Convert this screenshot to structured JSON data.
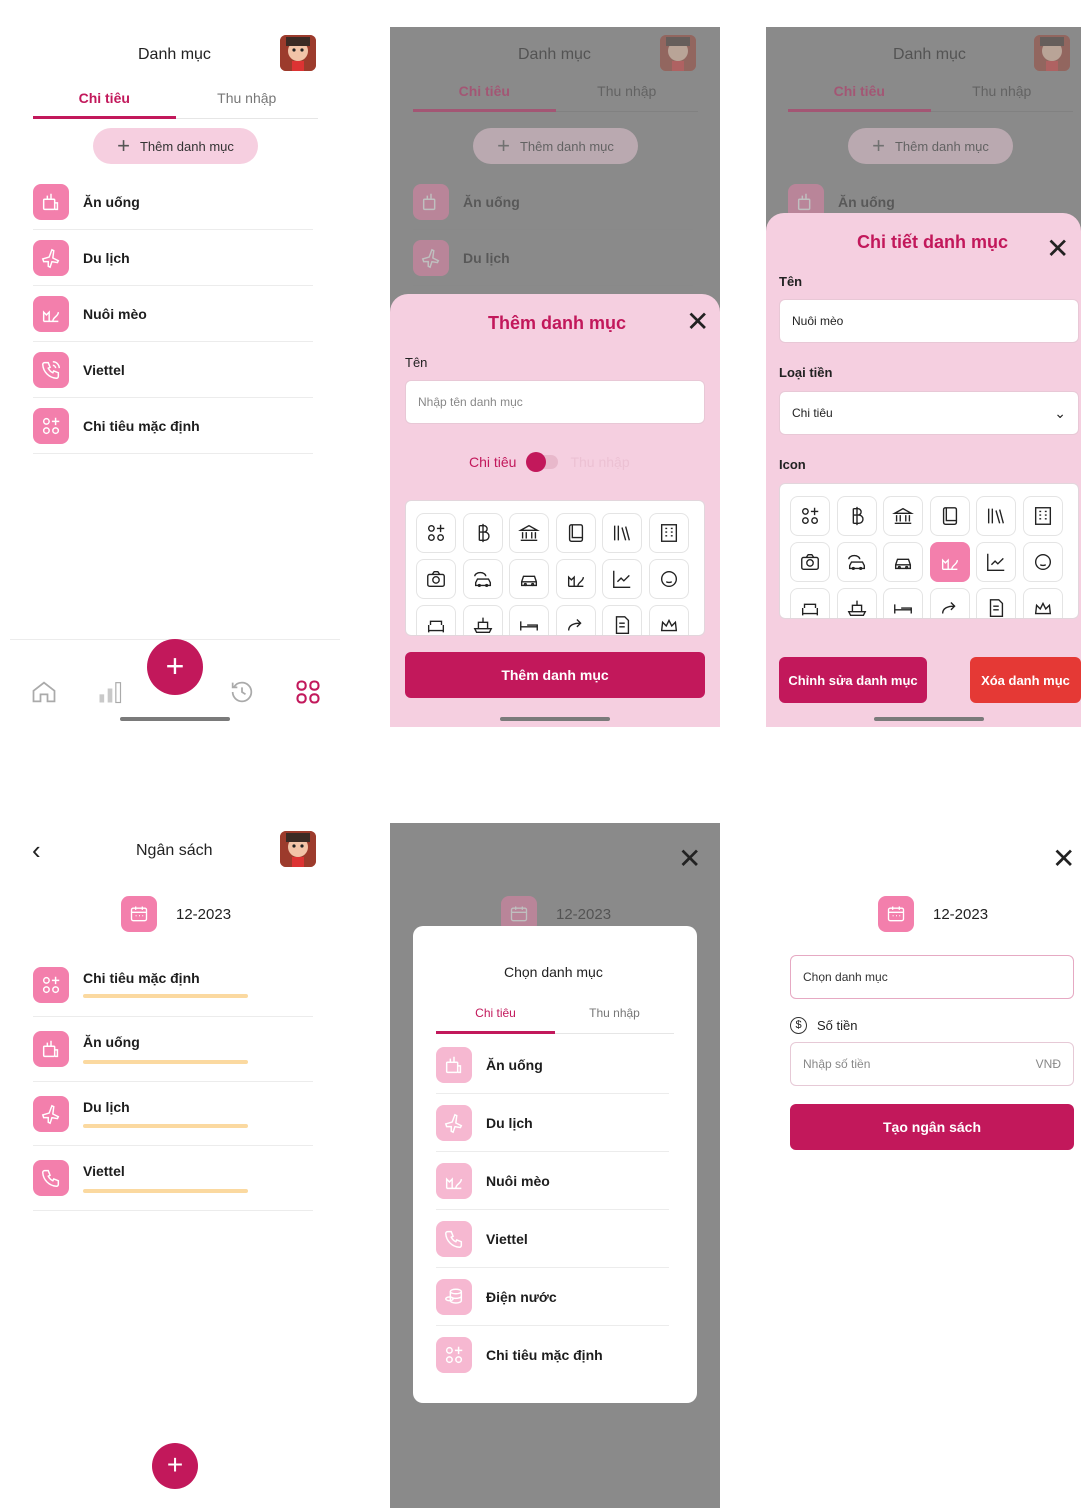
{
  "screen1": {
    "title": "Danh mục",
    "tabs": [
      "Chi tiêu",
      "Thu nhập"
    ],
    "add_button": "Thêm danh mục",
    "categories": [
      "Ăn uống",
      "Du lịch",
      "Nuôi mèo",
      "Viettel",
      "Chi tiêu mặc định"
    ],
    "fab": "+"
  },
  "screen2": {
    "title": "Danh mục",
    "tabs": [
      "Chi tiêu",
      "Thu nhập"
    ],
    "add_button": "Thêm danh mục",
    "categories": [
      "Ăn uống",
      "Du lịch"
    ],
    "sheet_title": "Thêm danh mục",
    "name_label": "Tên",
    "name_placeholder": "Nhập tên danh mục",
    "toggle_left": "Chi tiêu",
    "toggle_right": "Thu nhập",
    "submit": "Thêm danh mục"
  },
  "screen3": {
    "title": "Danh mục",
    "tabs": [
      "Chi tiêu",
      "Thu nhập"
    ],
    "add_button": "Thêm danh mục",
    "categories": [
      "Ăn uống"
    ],
    "sheet_title": "Chi tiết danh mục",
    "name_label": "Tên",
    "name_value": "Nuôi mèo",
    "type_label": "Loại tiền",
    "type_value": "Chi tiêu",
    "icon_label": "Icon",
    "edit_button": "Chỉnh sửa danh mục",
    "delete_button": "Xóa danh mục"
  },
  "screen4": {
    "title": "Ngân sách",
    "date": "12-2023",
    "budgets": [
      "Chi tiêu mặc định",
      "Ăn uống",
      "Du lịch",
      "Viettel"
    ],
    "fab": "+"
  },
  "screen5": {
    "date": "12-2023",
    "modal_title": "Chọn danh mục",
    "tabs": [
      "Chi tiêu",
      "Thu nhập"
    ],
    "categories": [
      "Ăn uống",
      "Du lịch",
      "Nuôi mèo",
      "Viettel",
      "Điện nước",
      "Chi tiêu mặc định"
    ]
  },
  "screen6": {
    "date": "12-2023",
    "category_placeholder": "Chọn danh mục",
    "amount_label": "Số tiền",
    "amount_placeholder": "Nhập số tiền",
    "currency": "VNĐ",
    "submit": "Tạo ngân sách"
  },
  "colors": {
    "primary": "#c2185b",
    "icon_bg": "#f37fac",
    "sheet_bg": "#f5cfe0",
    "danger": "#e53935",
    "progress": "#fbd9a0"
  }
}
